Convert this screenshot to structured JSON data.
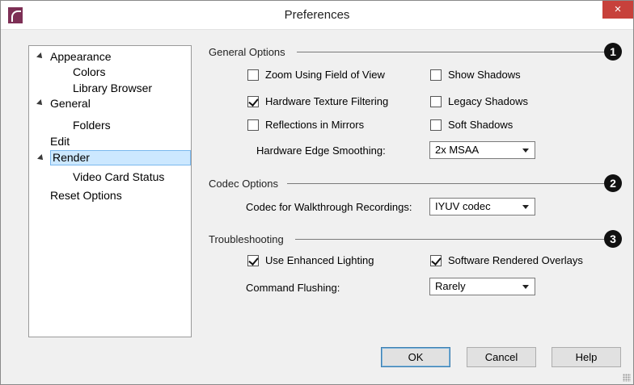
{
  "window": {
    "title": "Preferences",
    "close_glyph": "×"
  },
  "tree": [
    {
      "label": "Appearance",
      "expanded": true
    },
    {
      "label": "Colors"
    },
    {
      "label": "Library Browser"
    },
    {
      "label": "General",
      "expanded": true
    },
    {
      "label": "Folders"
    },
    {
      "label": "Edit"
    },
    {
      "label": "Render",
      "expanded": true,
      "selected": true
    },
    {
      "label": "Video Card Status"
    },
    {
      "label": "Reset Options"
    }
  ],
  "general": {
    "title": "General Options",
    "badge": "1",
    "zoom_fov": {
      "label": "Zoom Using Field of View",
      "checked": false
    },
    "show_shadows": {
      "label": "Show Shadows",
      "checked": false
    },
    "hw_texture": {
      "label": "Hardware Texture Filtering",
      "checked": true
    },
    "legacy_shadows": {
      "label": "Legacy Shadows",
      "checked": false
    },
    "reflections": {
      "label": "Reflections in Mirrors",
      "checked": false
    },
    "soft_shadows": {
      "label": "Soft Shadows",
      "checked": false
    },
    "edge_smoothing_label": "Hardware Edge Smoothing:",
    "edge_smoothing_value": "2x MSAA"
  },
  "codec": {
    "title": "Codec Options",
    "badge": "2",
    "label": "Codec for Walkthrough Recordings:",
    "value": "IYUV codec"
  },
  "troubleshooting": {
    "title": "Troubleshooting",
    "badge": "3",
    "enhanced_lighting": {
      "label": "Use Enhanced Lighting",
      "checked": true
    },
    "software_overlays": {
      "label": "Software Rendered Overlays",
      "checked": true
    },
    "flushing_label": "Command Flushing:",
    "flushing_value": "Rarely"
  },
  "buttons": {
    "ok": "OK",
    "cancel": "Cancel",
    "help": "Help"
  },
  "colors": {
    "close_button": "#c7413b",
    "selection": "#cce8ff",
    "app_icon": "#7d2f55"
  }
}
